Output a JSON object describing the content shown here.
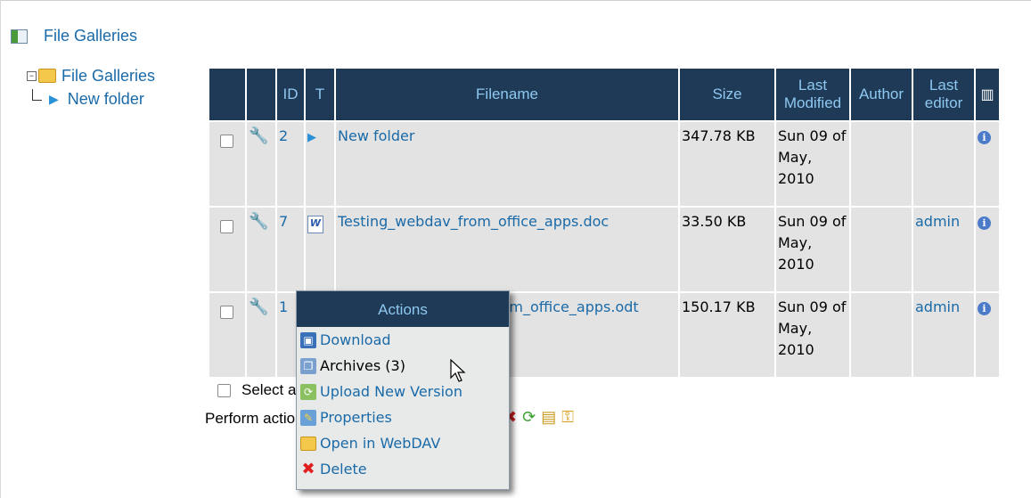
{
  "header": {
    "title": "File Galleries"
  },
  "tree": {
    "root": "File Galleries",
    "child": "New folder"
  },
  "table": {
    "headers": {
      "id": "ID",
      "type": "T",
      "filename": "Filename",
      "size": "Size",
      "last_modified": "Last Modified",
      "author": "Author",
      "last_editor": "Last editor"
    },
    "rows": [
      {
        "id": "2",
        "filename": "New folder",
        "size": "347.78 KB",
        "modified": "Sun 09 of May, 2010",
        "author": "",
        "editor": "",
        "type_icon": "folder-arrow-icon"
      },
      {
        "id": "7",
        "filename": "Testing_webdav_from_office_apps.doc",
        "size": "33.50 KB",
        "modified": "Sun 09 of May, 2010",
        "author": "",
        "editor": "admin",
        "type_icon": "word-doc-icon"
      },
      {
        "id": "1",
        "filename": "Testing_webdav_from_office_apps.odt",
        "size": "150.17 KB",
        "modified": "Sun 09 of May, 2010",
        "author": "",
        "editor": "admin",
        "type_icon": "odt-doc-icon"
      }
    ]
  },
  "select_all_label": "Select all",
  "perform_action_label": "Perform action with checked:",
  "menu": {
    "title": "Actions",
    "items": [
      {
        "label": "Download",
        "icon": "floppy-disk-icon"
      },
      {
        "label": "Archives (3)",
        "icon": "archives-icon"
      },
      {
        "label": "Upload New Version",
        "icon": "upload-icon"
      },
      {
        "label": "Properties",
        "icon": "pencil-icon"
      },
      {
        "label": "Open in WebDAV",
        "icon": "folder-icon"
      },
      {
        "label": "Delete",
        "icon": "red-x-icon"
      }
    ]
  },
  "colors": {
    "header_bg": "#1f3a56",
    "header_text": "#8ec8f0",
    "link": "#1a6aa8",
    "row_bg": "#e3e3e3"
  }
}
